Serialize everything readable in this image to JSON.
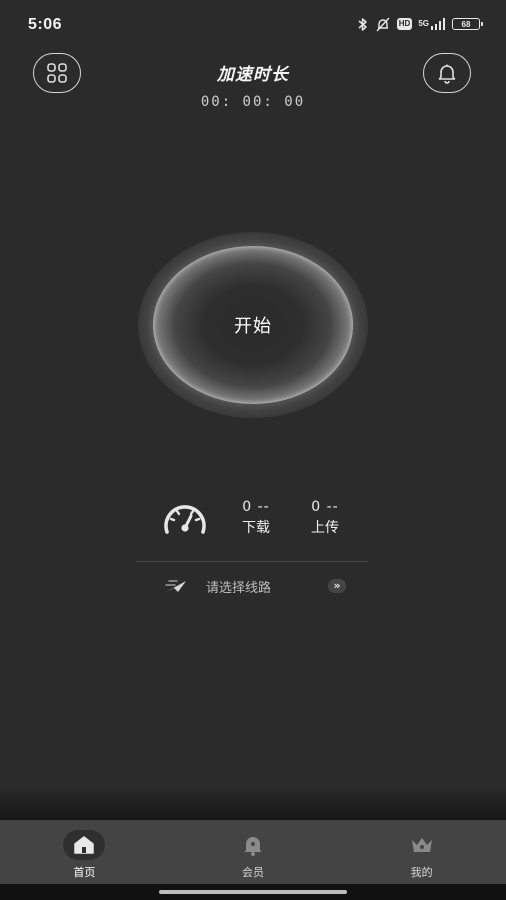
{
  "status_bar": {
    "time": "5:06",
    "hd": "HD",
    "network": "5G",
    "battery": "68",
    "icons": [
      "bluetooth-icon",
      "silent-bell-icon",
      "hd-icon",
      "signal-icon",
      "battery-icon"
    ]
  },
  "header": {
    "title": "加速时长",
    "timer": "00: 00: 00",
    "menu_icon": "grid-icon",
    "notify_icon": "bell-icon"
  },
  "main": {
    "start_label": "开始",
    "download": {
      "value": "0 --",
      "label": "下载"
    },
    "upload": {
      "value": "0 --",
      "label": "上传"
    },
    "route_placeholder": "请选择线路",
    "route_arrow": "»"
  },
  "tabs": [
    {
      "label": "首页",
      "icon": "home-icon",
      "active": true
    },
    {
      "label": "会员",
      "icon": "bell-badge-icon",
      "active": false
    },
    {
      "label": "我的",
      "icon": "crown-icon",
      "active": false
    }
  ],
  "colors": {
    "background": "#2b2b2b",
    "tab_bar": "#444444",
    "text": "#e8e8e8",
    "accent": "#ffffff"
  }
}
